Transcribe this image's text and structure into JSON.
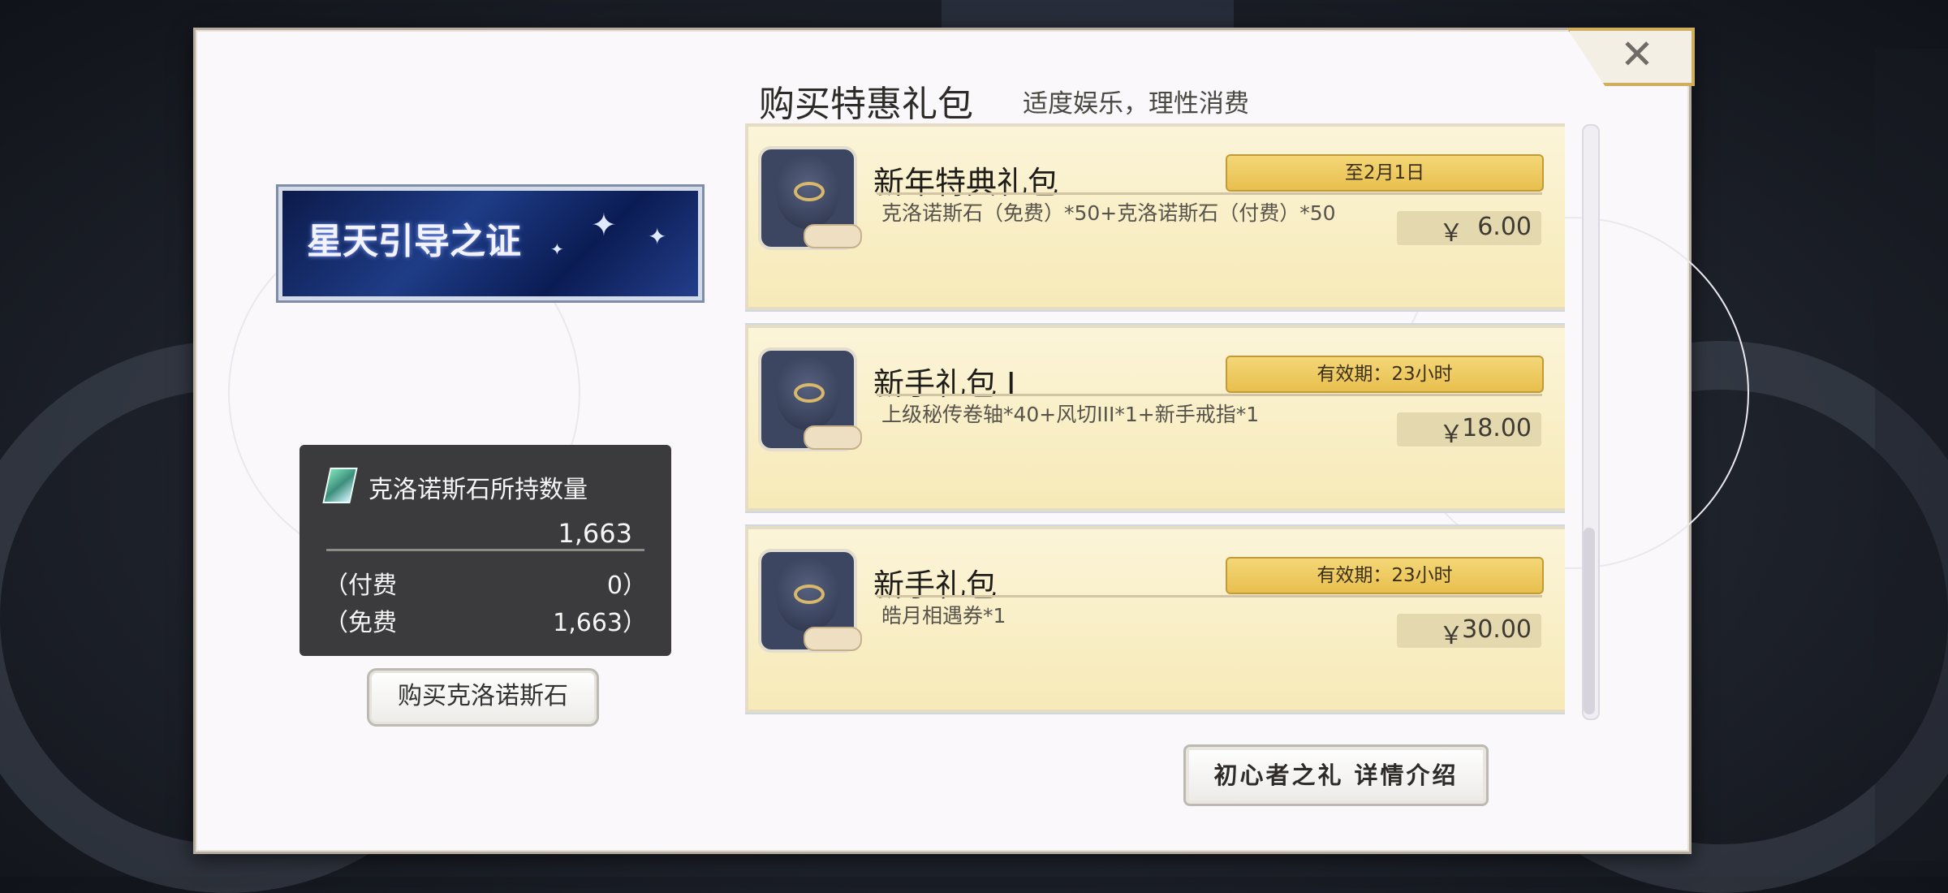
{
  "dialog": {
    "title": "购买特惠礼包",
    "subtitle": "适度娱乐，理性消费",
    "close_icon": "close-icon"
  },
  "banner": {
    "text": "星天引导之证"
  },
  "stones": {
    "label": "克洛诺斯石所持数量",
    "total": "1,663",
    "paid_label": "（付费",
    "paid_value": "0）",
    "free_label": "（免费",
    "free_value": "1,663）"
  },
  "buy_stones_button": "购买克洛诺斯石",
  "packs": [
    {
      "title": "新年特典礼包",
      "badge": "至2月1日",
      "desc": "克洛诺斯石（免费）*50+克洛诺斯石（付费）*50",
      "currency": "￥",
      "price": "6.00"
    },
    {
      "title": "新手礼包 I",
      "badge": "有效期：23小时",
      "desc": "上级秘传卷轴*40+风切III*1+新手戒指*1",
      "currency": "￥",
      "price": "18.00"
    },
    {
      "title": "新手礼包",
      "badge": "有效期：23小时",
      "desc": "皓月相遇券*1",
      "currency": "￥",
      "price": "30.00"
    }
  ],
  "detail_button": "初心者之礼 详情介绍",
  "colors": {
    "dialog_bg": "#faf8fb",
    "pack_bg": "#f7eab8",
    "badge_gold": "#e8bf4e",
    "stones_panel": "#3b3b3d"
  }
}
